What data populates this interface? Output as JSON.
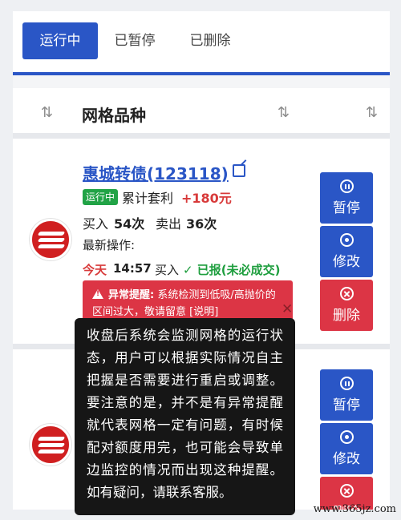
{
  "tabs": [
    {
      "label": "运行中"
    },
    {
      "label": "已暂停"
    },
    {
      "label": "已删除"
    }
  ],
  "header": {
    "title": "网格品种"
  },
  "rows": [
    {
      "fund_name": "惠城转债(123118)",
      "status_badge": "运行中",
      "profit_label": "累计套利",
      "profit_value": "+180元",
      "buy_label": "买入",
      "buy_count": "54次",
      "sell_label": "卖出",
      "sell_count": "36次",
      "latest_label": "最新操作:",
      "latest_day": "今天",
      "latest_time": "14:57",
      "latest_action": "买入",
      "latest_status": "✓ 已报(未必成交)",
      "alert_title": "异常提醒:",
      "alert_text": "系统检测到低吸/高抛价的区间过大，敬请留意 [说明]"
    }
  ],
  "buttons": {
    "pause": "暂停",
    "edit": "修改",
    "delete": "删除"
  },
  "tooltip": {
    "text": "收盘后系统会监测网格的运行状态，用户可以根据实际情况自主把握是否需要进行重启或调整。要注意的是，并不是有异常提醒就代表网格一定有问题，有时候配对额度用完，也可能会导致单边监控的情况而出现这种提醒。如有疑问，请联系客服。"
  },
  "watermark": "www.365jz.com",
  "colors": {
    "primary": "#2a56c6",
    "danger": "#dc3545",
    "success": "#21a346",
    "profit": "#d83a3a"
  }
}
